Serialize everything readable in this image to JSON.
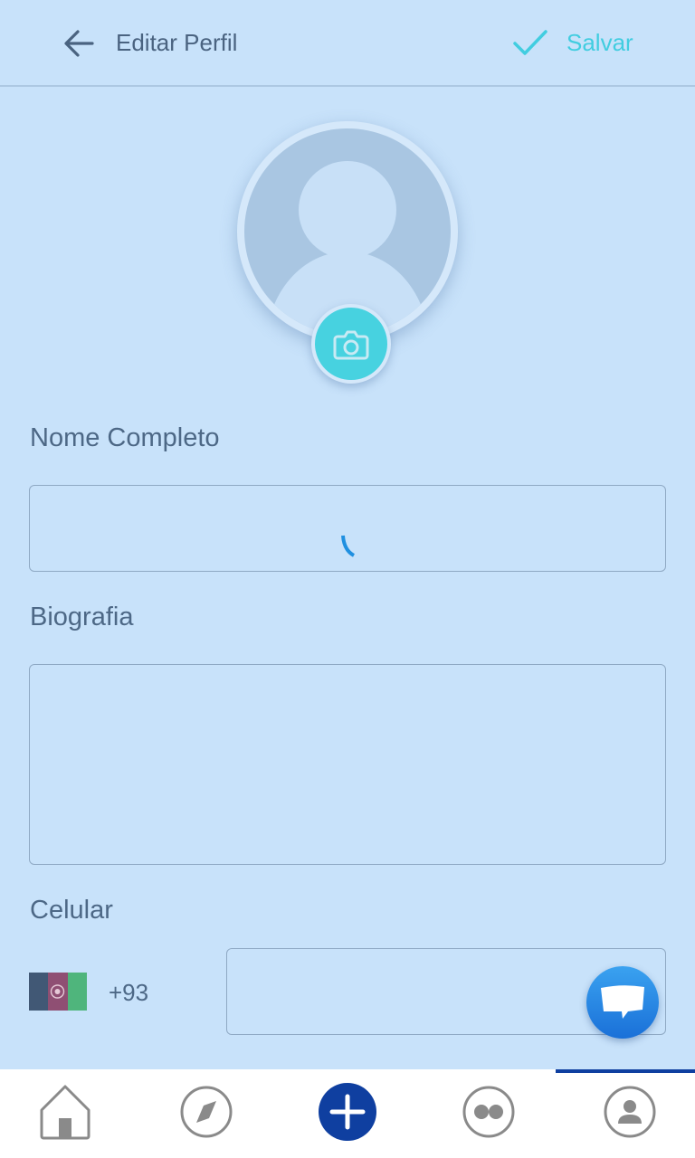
{
  "header": {
    "title": "Editar Perfil",
    "save_label": "Salvar",
    "back_icon": "arrow-left-icon",
    "save_icon": "check-icon"
  },
  "avatar": {
    "icon": "user-placeholder-icon",
    "camera_icon": "camera-icon"
  },
  "form": {
    "name_label": "Nome Completo",
    "name_value": "",
    "bio_label": "Biografia",
    "bio_value": "",
    "phone_label": "Celular",
    "country_code": "+93",
    "country_flag": "afghanistan-flag-icon",
    "phone_value": ""
  },
  "chat_fab": {
    "icon": "chat-bubble-icon"
  },
  "bottom_nav": {
    "items": [
      {
        "icon": "home-icon"
      },
      {
        "icon": "compass-icon"
      },
      {
        "icon": "add-icon"
      },
      {
        "icon": "stories-icon"
      },
      {
        "icon": "profile-icon"
      }
    ],
    "active_index": 4
  },
  "colors": {
    "background": "#c8e2fa",
    "accent": "#41cde0",
    "nav_active": "#0f3fa0",
    "chat_fab": "#1f7fe0"
  }
}
